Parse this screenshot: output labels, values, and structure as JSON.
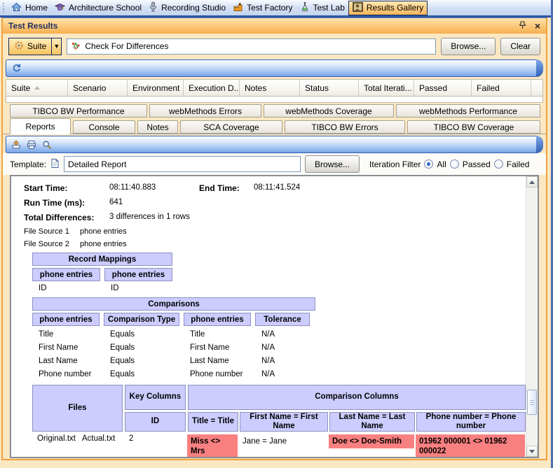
{
  "topbar": {
    "items": [
      {
        "label": "Home",
        "icon": "home-icon"
      },
      {
        "label": "Architecture School",
        "icon": "graduation-cap-icon"
      },
      {
        "label": "Recording Studio",
        "icon": "microphone-icon"
      },
      {
        "label": "Test Factory",
        "icon": "factory-icon"
      },
      {
        "label": "Test Lab",
        "icon": "flask-icon"
      },
      {
        "label": "Results Gallery",
        "icon": "picture-icon",
        "active": true
      }
    ]
  },
  "panel": {
    "title": "Test Results"
  },
  "controls": {
    "suite_label": "Suite",
    "query_value": "Check For Differences",
    "browse_label": "Browse...",
    "clear_label": "Clear"
  },
  "results_table": {
    "columns": [
      "Suite",
      "Scenario",
      "Environment",
      "Execution D...",
      "Notes",
      "Status",
      "Total Iterati...",
      "Passed",
      "Failed"
    ]
  },
  "tabs": {
    "row1": [
      "TIBCO BW Performance",
      "webMethods Errors",
      "webMethods Coverage",
      "webMethods Performance"
    ],
    "row2": [
      "Reports",
      "Console",
      "Notes",
      "SCA Coverage",
      "TIBCO BW Errors",
      "TIBCO BW Coverage"
    ],
    "active": "Reports"
  },
  "template_bar": {
    "label": "Template:",
    "value": "Detailed Report",
    "browse_label": "Browse...",
    "filter_label": "Iteration Filter",
    "options": [
      "All",
      "Passed",
      "Failed"
    ],
    "selected": "All"
  },
  "report": {
    "summary": {
      "start_time_label": "Start Time:",
      "start_time": "08:11:40.883",
      "end_time_label": "End Time:",
      "end_time": "08:11:41.524",
      "run_time_label": "Run Time (ms):",
      "run_time": "641",
      "total_differences_label": "Total Differences:",
      "total_differences": "3 differences in 1 rows"
    },
    "file_sources": [
      {
        "label": "File Source 1",
        "value": "phone entries"
      },
      {
        "label": "File Source 2",
        "value": "phone entries"
      }
    ],
    "record_mappings": {
      "title": "Record Mappings",
      "columns": [
        "phone entries",
        "phone entries"
      ],
      "rows": [
        [
          "ID",
          "ID"
        ]
      ]
    },
    "comparisons": {
      "title": "Comparisons",
      "columns": [
        "phone entries",
        "Comparison Type",
        "phone entries",
        "Tolerance"
      ],
      "rows": [
        [
          "Title",
          "Equals",
          "Title",
          "N/A"
        ],
        [
          "First Name",
          "Equals",
          "First Name",
          "N/A"
        ],
        [
          "Last Name",
          "Equals",
          "Last Name",
          "N/A"
        ],
        [
          "Phone number",
          "Equals",
          "Phone number",
          "N/A"
        ]
      ]
    },
    "files_table": {
      "files_label": "Files",
      "key_columns_label": "Key Columns",
      "comparison_columns_label": "Comparison Columns",
      "id_label": "ID",
      "comparison_headers": [
        "Title = Title",
        "First Name = First Name",
        "Last Name = Last Name",
        "Phone number = Phone number"
      ],
      "row": {
        "file1": "Original.txt",
        "file2": "Actual.txt",
        "id": "2",
        "cells": [
          {
            "text": "Miss <> Mrs",
            "diff": true
          },
          {
            "text": "Jane = Jane",
            "diff": false
          },
          {
            "text": "Doe <> Doe-Smith",
            "diff": true
          },
          {
            "text": "01962 000001 <> 01962 000022",
            "diff": true
          }
        ]
      }
    }
  },
  "colors": {
    "accent_orange": "#F7AE4E",
    "lavender": "#CCCCFF",
    "diff_red": "#F98080",
    "toolbar_blue": "#78A6E6"
  }
}
